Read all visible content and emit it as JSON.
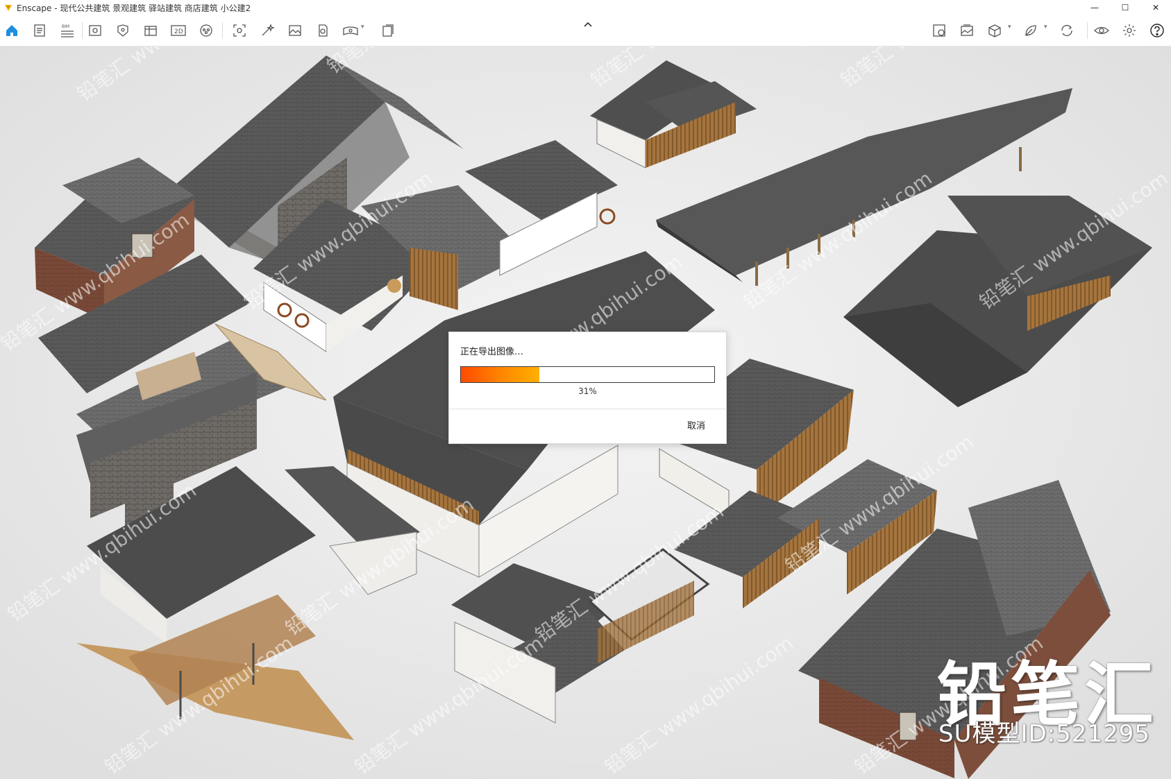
{
  "titlebar": {
    "title": "Enscape - 现代公共建筑 景观建筑 驿站建筑 商店建筑 小公建2",
    "minimize_symbol": "—",
    "maximize_symbol": "☐",
    "close_symbol": "✕"
  },
  "toolbar": {
    "icons": [
      "home-icon",
      "document-icon",
      "bim-icon",
      "view-icon",
      "asset-icon",
      "table-icon",
      "export-2d-icon",
      "vr-icon",
      "screenshot-icon",
      "magic-wand-icon",
      "image-icon",
      "capture-icon",
      "panorama-icon",
      "batch-export-icon",
      "settings-icon",
      "gallery-icon",
      "package-icon",
      "leaf-icon",
      "sync-icon",
      "eye-icon",
      "gear-icon",
      "help-icon"
    ],
    "bim_label": "BIM",
    "export2d_label": "2D",
    "accent_color": "#1d8fe0"
  },
  "dialog": {
    "title": "正在导出图像…",
    "progress": 0.31,
    "progress_text": "31%",
    "cancel_label": "取消"
  },
  "watermark": {
    "brand": "铅笔汇",
    "model_id": "SU模型ID:521295",
    "repeat_text": "铅笔汇 www.qbihui.com"
  },
  "colors": {
    "progress_start": "#ff4a00",
    "progress_end": "#ffb000",
    "roof_dark": "#4a4a4a",
    "ground": "#ececec"
  }
}
